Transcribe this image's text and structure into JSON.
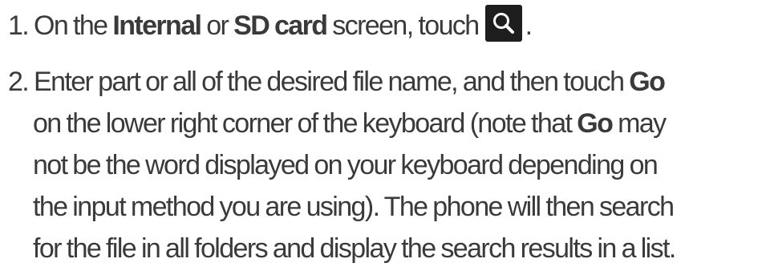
{
  "step1": {
    "number": "1.",
    "t1": "On the",
    "b1": "Internal",
    "t2": "or",
    "b2": "SD card",
    "t3": "screen, touch",
    "icon": "search-icon",
    "t4": "."
  },
  "step2": {
    "number": "2.",
    "l1a": "Enter part or all of the desired file name, and then touch",
    "l1b": "Go",
    "l2a": "on the lower right corner of the keyboard (note that",
    "l2b": "Go",
    "l2c": "may",
    "l3": "not be the word displayed on your keyboard depending on",
    "l4": "the input method you are using). The phone will then search",
    "l5": "for the file in all folders and display the search results in a list."
  }
}
